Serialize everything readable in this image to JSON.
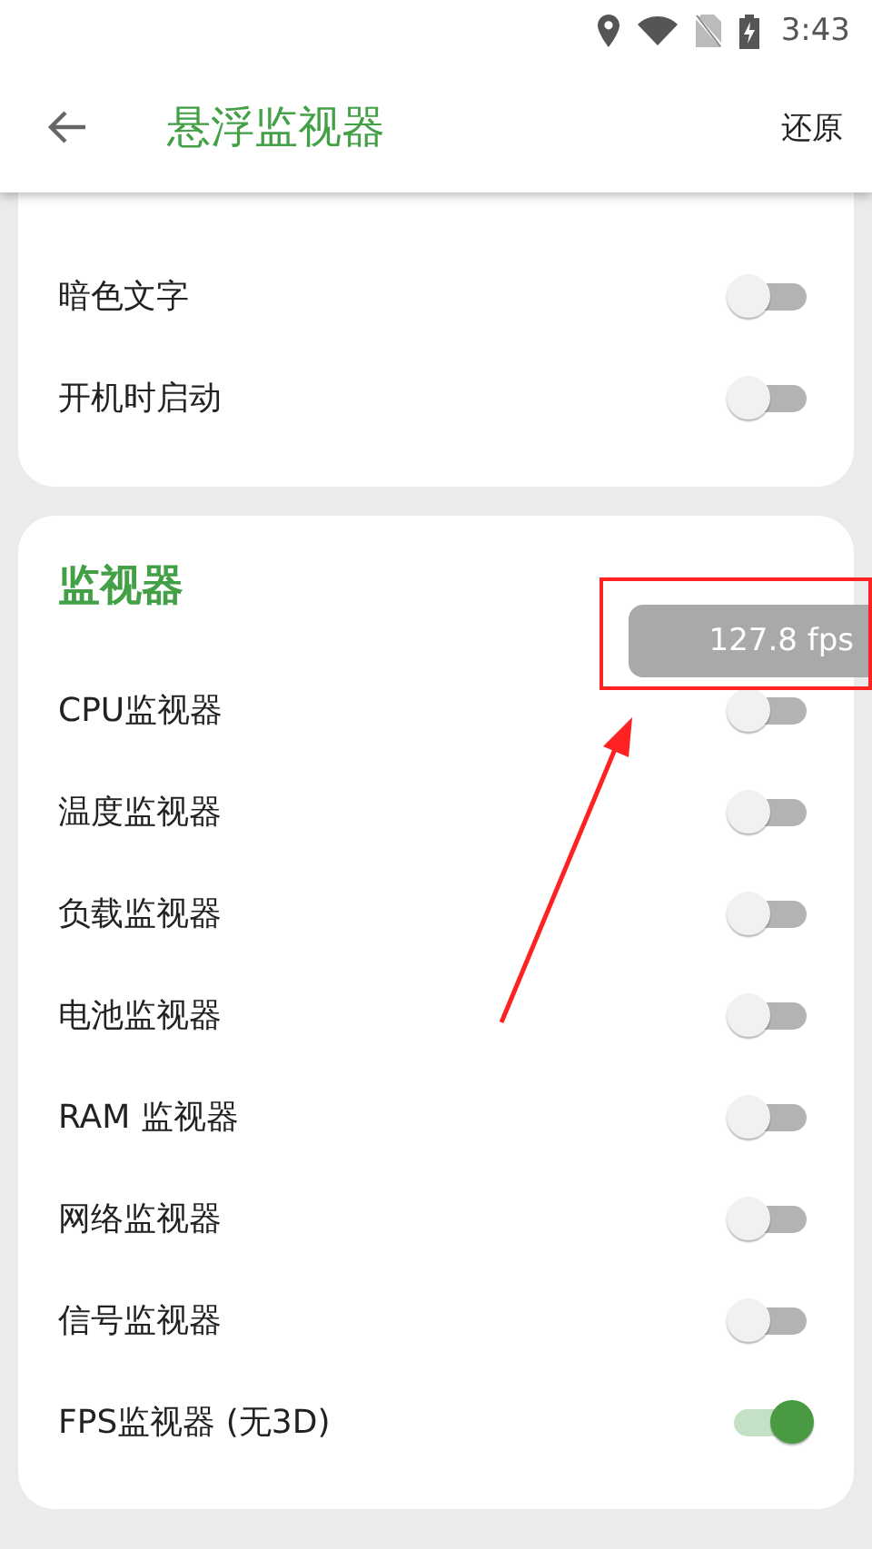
{
  "status_bar": {
    "time": "3:43"
  },
  "app_bar": {
    "title": "悬浮监视器",
    "action": "还原"
  },
  "sections": [
    {
      "items": [
        {
          "label": "暗色文字",
          "on": false
        },
        {
          "label": "开机时启动",
          "on": false
        }
      ]
    },
    {
      "title": "监视器",
      "items": [
        {
          "label": "CPU监视器",
          "on": false
        },
        {
          "label": "温度监视器",
          "on": false
        },
        {
          "label": "负载监视器",
          "on": false
        },
        {
          "label": "电池监视器",
          "on": false
        },
        {
          "label": "RAM 监视器",
          "on": false
        },
        {
          "label": "网络监视器",
          "on": false
        },
        {
          "label": "信号监视器",
          "on": false
        },
        {
          "label": "FPS监视器 (无3D)",
          "on": true
        }
      ]
    }
  ],
  "overlay": {
    "fps": "127.8 fps"
  }
}
